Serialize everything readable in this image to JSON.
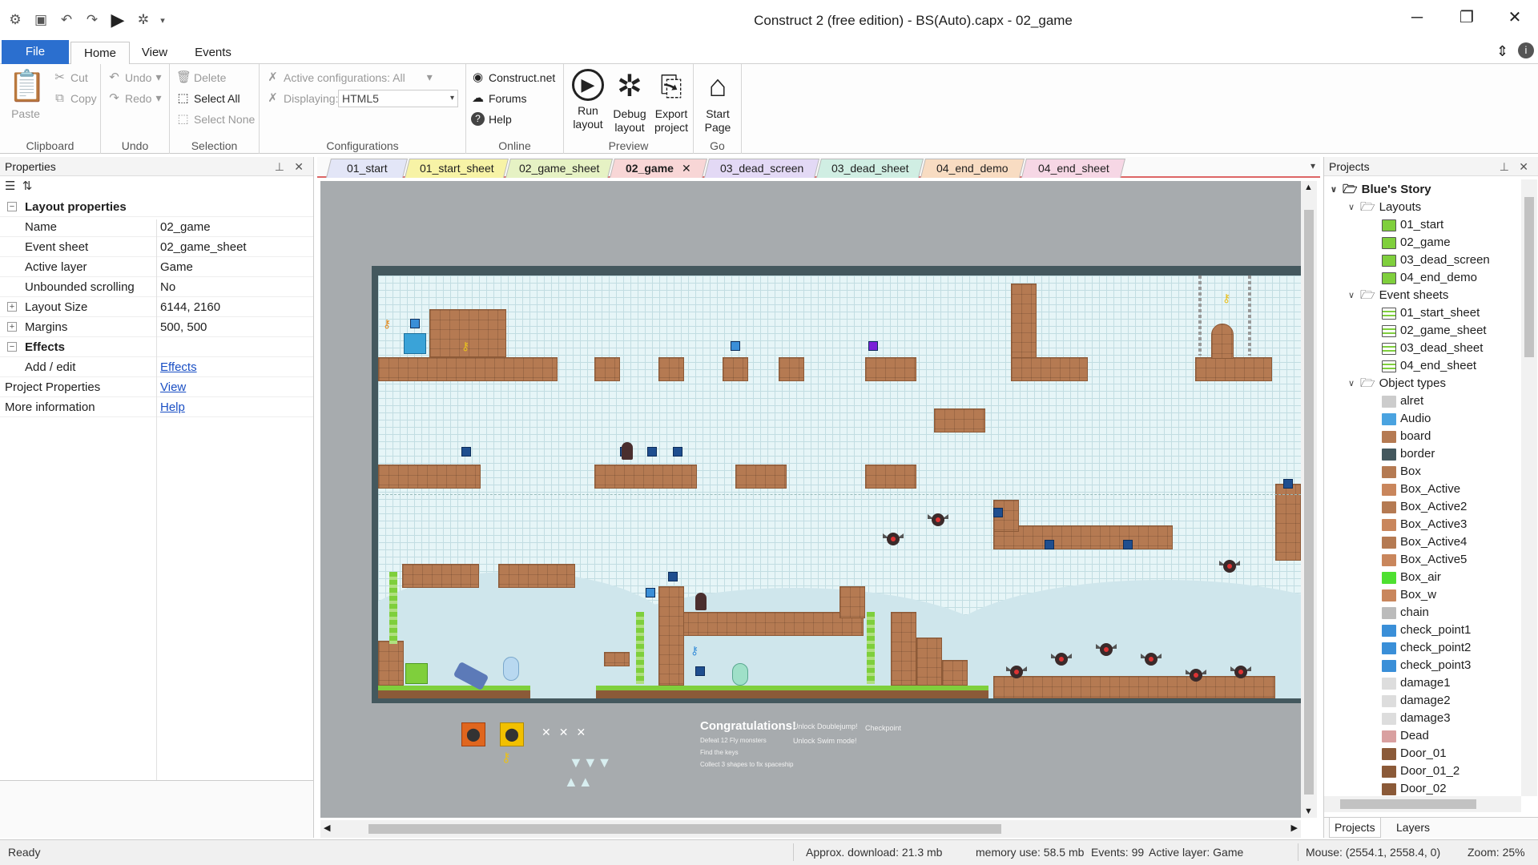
{
  "window": {
    "title": "Construct 2 (free edition) - BS(Auto).capx - 02_game",
    "controls": [
      "─",
      "❐",
      "✕"
    ]
  },
  "ribbon": {
    "tabs": [
      "File",
      "Home",
      "View",
      "Events"
    ],
    "clipboard": {
      "paste": "Paste",
      "cut": "Cut",
      "copy": "Copy",
      "label": "Clipboard"
    },
    "undo": {
      "undo": "Undo",
      "redo": "Redo",
      "label": "Undo"
    },
    "selection": {
      "delete": "Delete",
      "select_all": "Select All",
      "select_none": "Select None",
      "label": "Selection"
    },
    "configurations": {
      "active": "Active configurations: All",
      "displaying_label": "Displaying:",
      "displaying_value": "HTML5",
      "label": "Configurations"
    },
    "online": {
      "construct": "Construct.net",
      "forums": "Forums",
      "help": "Help",
      "label": "Online"
    },
    "preview": {
      "run": "Run layout",
      "debug": "Debug layout",
      "export": "Export project",
      "label": "Preview"
    },
    "go": {
      "start": "Start Page",
      "label": "Go"
    }
  },
  "properties": {
    "title": "Properties",
    "section_layout": "Layout properties",
    "rows": [
      {
        "k": "Name",
        "v": "02_game"
      },
      {
        "k": "Event sheet",
        "v": "02_game_sheet"
      },
      {
        "k": "Active layer",
        "v": "Game"
      },
      {
        "k": "Unbounded scrolling",
        "v": "No"
      },
      {
        "k": "Layout Size",
        "v": "6144, 2160"
      },
      {
        "k": "Margins",
        "v": "500, 500"
      }
    ],
    "section_effects": "Effects",
    "effects_row": {
      "k": "Add / edit",
      "v": "Effects"
    },
    "project_props": {
      "k": "Project Properties",
      "v": "View"
    },
    "more_info": {
      "k": "More information",
      "v": "Help"
    }
  },
  "doc_tabs": [
    {
      "label": "01_start",
      "color": "#e3e6f7"
    },
    {
      "label": "01_start_sheet",
      "color": "#f7f3a6"
    },
    {
      "label": "02_game_sheet",
      "color": "#e6f2c4"
    },
    {
      "label": "02_game",
      "color": "#f8d6d6"
    },
    {
      "label": "03_dead_screen",
      "color": "#e3d9f5"
    },
    {
      "label": "03_dead_sheet",
      "color": "#d0eee3"
    },
    {
      "label": "04_end_demo",
      "color": "#f8dcc2"
    },
    {
      "label": "04_end_sheet",
      "color": "#f6d7e5"
    }
  ],
  "canvas_text": {
    "congrats": "Congratulations!",
    "defeat": "Defeat 12 Fly monsters",
    "keys": "Find the keys",
    "collect": "Collect 3 shapes to fix spaceship",
    "doublejump": "Unlock Doublejump!",
    "swim": "Unlock Swim mode!",
    "checkpoint": "Checkpoint"
  },
  "projects": {
    "title": "Projects",
    "root": "Blue's Story",
    "layouts_label": "Layouts",
    "layouts": [
      "01_start",
      "02_game",
      "03_dead_screen",
      "04_end_demo"
    ],
    "eventsheets_label": "Event sheets",
    "eventsheets": [
      "01_start_sheet",
      "02_game_sheet",
      "03_dead_sheet",
      "04_end_sheet"
    ],
    "objecttypes_label": "Object types",
    "objects": [
      "alret",
      "Audio",
      "board",
      "border",
      "Box",
      "Box_Active",
      "Box_Active2",
      "Box_Active3",
      "Box_Active4",
      "Box_Active5",
      "Box_air",
      "Box_w",
      "chain",
      "check_point1",
      "check_point2",
      "check_point3",
      "damage1",
      "damage2",
      "damage3",
      "Dead",
      "Door_01",
      "Door_01_2",
      "Door_02"
    ],
    "bottom_tabs": [
      "Projects",
      "Layers"
    ]
  },
  "status": {
    "ready": "Ready",
    "download": "Approx. download: 21.3 mb",
    "memory": "memory use: 58.5 mb",
    "events": "Events: 99",
    "layer": "Active layer: Game",
    "mouse": "Mouse: (2554.1, 2558.4, 0)",
    "zoom": "Zoom: 25%"
  }
}
